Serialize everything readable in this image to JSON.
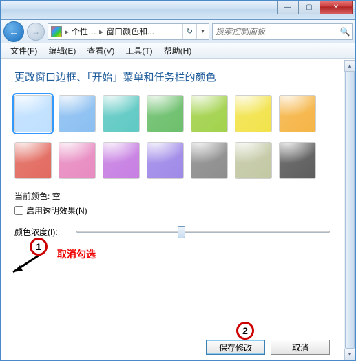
{
  "titlebar": {
    "min": "—",
    "max": "▢",
    "close": "✕"
  },
  "address": {
    "back": "←",
    "fwd": "→",
    "crumb1": "个性…",
    "crumb2": "窗口颜色和...",
    "sep": "▸",
    "dropdown": "▾",
    "refresh": "↻"
  },
  "search": {
    "placeholder": "搜索控制面板",
    "icon": "🔍"
  },
  "menu": {
    "file": "文件(F)",
    "edit": "编辑(E)",
    "view": "查看(V)",
    "tools": "工具(T)",
    "help": "帮助(H)"
  },
  "heading": "更改窗口边框、「开始」菜单和任务栏的颜色",
  "colors": [
    {
      "bg": "#bfe0ff",
      "selected": true
    },
    {
      "bg": "#8bbff1"
    },
    {
      "bg": "#5fc9c3"
    },
    {
      "bg": "#6cbf6c"
    },
    {
      "bg": "#a2d24c"
    },
    {
      "bg": "#f2e34b"
    },
    {
      "bg": "#f5b547"
    },
    {
      "bg": "#e26a5f"
    },
    {
      "bg": "#e88bc1"
    },
    {
      "bg": "#c77fe2"
    },
    {
      "bg": "#9f89e8"
    },
    {
      "bg": "#8d8d8d"
    },
    {
      "bg": "#c3c8a4"
    },
    {
      "bg": "#5d5d5d"
    }
  ],
  "current_color_label": "当前颜色: 空",
  "transparency": {
    "label": "启用透明效果(N)",
    "checked": false
  },
  "intensity_label": "颜色浓度(I):",
  "buttons": {
    "save": "保存修改",
    "cancel": "取消"
  },
  "annotations": {
    "n1": "1",
    "n2": "2",
    "hint": "取消勾选"
  },
  "scroll": {
    "up": "▴",
    "down": "▾"
  }
}
